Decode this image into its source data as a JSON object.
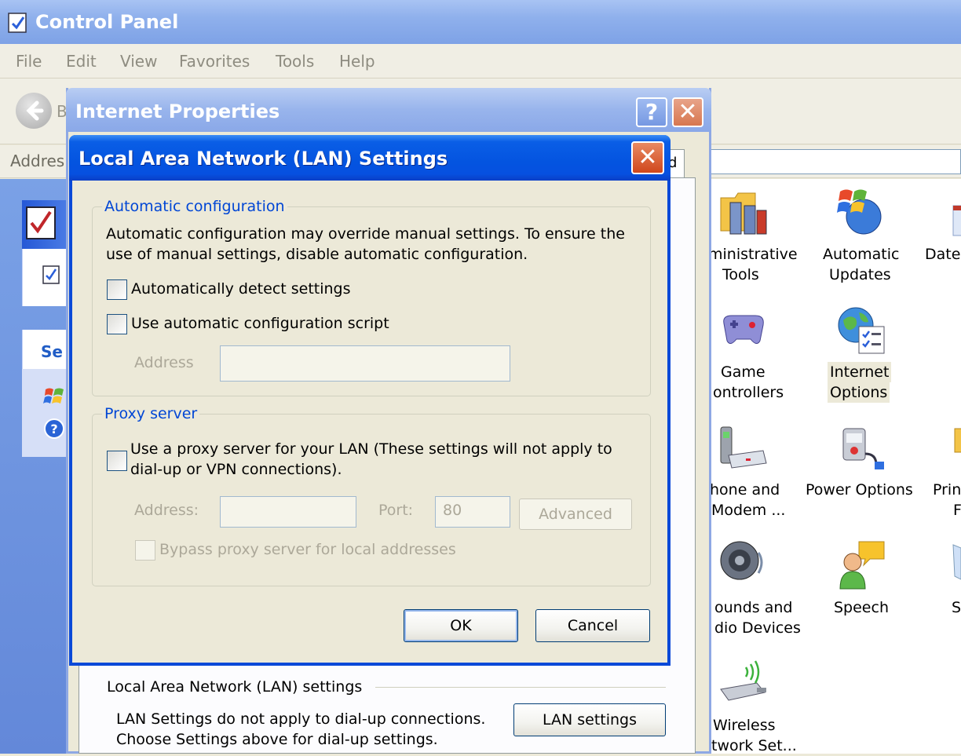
{
  "control_panel": {
    "title": "Control Panel",
    "menu": [
      "File",
      "Edit",
      "View",
      "Favorites",
      "Tools",
      "Help"
    ],
    "toolbar": {
      "back_label_fragment": "B"
    },
    "address_label": "Addres",
    "sidebar": {
      "section_title_fragment": "Se"
    },
    "items": [
      {
        "line1": "ministrative",
        "line2": "Tools",
        "icon": "administrative-tools-icon"
      },
      {
        "line1": "Automatic",
        "line2": "Updates",
        "icon": "automatic-updates-icon"
      },
      {
        "line1": "Date",
        "line2": "",
        "icon": "date-time-icon"
      },
      {
        "line1": "Game",
        "line2": "ontrollers",
        "icon": "game-controllers-icon"
      },
      {
        "line1": "Internet",
        "line2": "Options",
        "icon": "internet-options-icon"
      },
      {
        "line1": "hone and",
        "line2": "Modem ...",
        "icon": "phone-modem-icon"
      },
      {
        "line1": "Power Options",
        "line2": "",
        "icon": "power-options-icon"
      },
      {
        "line1": "Prin",
        "line2": "F",
        "icon": "printers-icon"
      },
      {
        "line1": "ounds and",
        "line2": "dio Devices",
        "icon": "sounds-audio-icon"
      },
      {
        "line1": "Speech",
        "line2": "",
        "icon": "speech-icon"
      },
      {
        "line1": "S",
        "line2": "",
        "icon": "system-icon"
      },
      {
        "line1": "Wireless",
        "line2": "twork Set...",
        "icon": "wireless-network-icon"
      }
    ]
  },
  "internet_properties": {
    "title": "Internet Properties",
    "help_glyph": "?",
    "close_glyph": "✕",
    "tab_edge": "d",
    "lan_section": {
      "label": "Local Area Network (LAN) settings",
      "desc_line1": "LAN Settings do not apply to dial-up connections.",
      "desc_line2": "Choose Settings above for dial-up settings.",
      "button": "LAN settings"
    }
  },
  "lan_dialog": {
    "title": "Local Area Network (LAN) Settings",
    "close_glyph": "✕",
    "auto_config": {
      "title": "Automatic configuration",
      "desc_line1": "Automatic configuration may override manual settings.  To ensure the",
      "desc_line2": "use of manual settings, disable automatic configuration.",
      "detect_label": "Automatically detect settings",
      "script_label": "Use automatic configuration script",
      "address_label": "Address",
      "address_value": ""
    },
    "proxy": {
      "title": "Proxy server",
      "use_line1": "Use a proxy server for your LAN (These settings will not apply to",
      "use_line2": "dial-up or VPN connections).",
      "address_label": "Address:",
      "address_value": "",
      "port_label": "Port:",
      "port_value": "80",
      "advanced": "Advanced",
      "bypass_label": "Bypass proxy server for local addresses"
    },
    "ok": "OK",
    "cancel": "Cancel"
  },
  "colors": {
    "xp_title_blue": "#0454e0",
    "inactive_title": "#8fb0ec",
    "group_title": "#0046d5",
    "close_red": "#d0471c",
    "dialog_face": "#ece9d8"
  }
}
